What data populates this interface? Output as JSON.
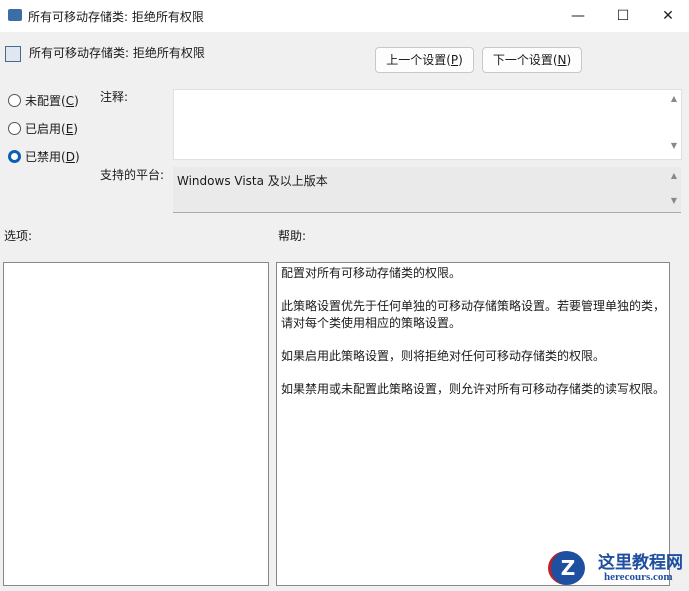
{
  "window": {
    "title": "所有可移动存储类: 拒绝所有权限",
    "minimize": "—",
    "maximize": "☐",
    "close": "✕"
  },
  "header": {
    "title": "所有可移动存储类: 拒绝所有权限",
    "prev_label": "上一个设置(",
    "prev_key": "P",
    "next_label": "下一个设置(",
    "next_key": "N",
    "close_paren": ")"
  },
  "state": {
    "options": [
      {
        "label": "未配置(",
        "key": "C",
        "selected": false
      },
      {
        "label": "已启用(",
        "key": "E",
        "selected": false
      },
      {
        "label": "已禁用(",
        "key": "D",
        "selected": true
      }
    ]
  },
  "comment": {
    "label": "注释:",
    "value": ""
  },
  "platform": {
    "label": "支持的平台:",
    "value": "Windows Vista 及以上版本"
  },
  "options_label": "选项:",
  "help_label": "帮助:",
  "help_paragraphs": [
    "配置对所有可移动存储类的权限。",
    "此策略设置优先于任何单独的可移动存储策略设置。若要管理单独的类，请对每个类使用相应的策略设置。",
    "如果启用此策略设置，则将拒绝对任何可移动存储类的权限。",
    "如果禁用或未配置此策略设置，则允许对所有可移动存储类的读写权限。"
  ],
  "watermark": {
    "text": "这里教程网",
    "url": "herecours.com"
  }
}
